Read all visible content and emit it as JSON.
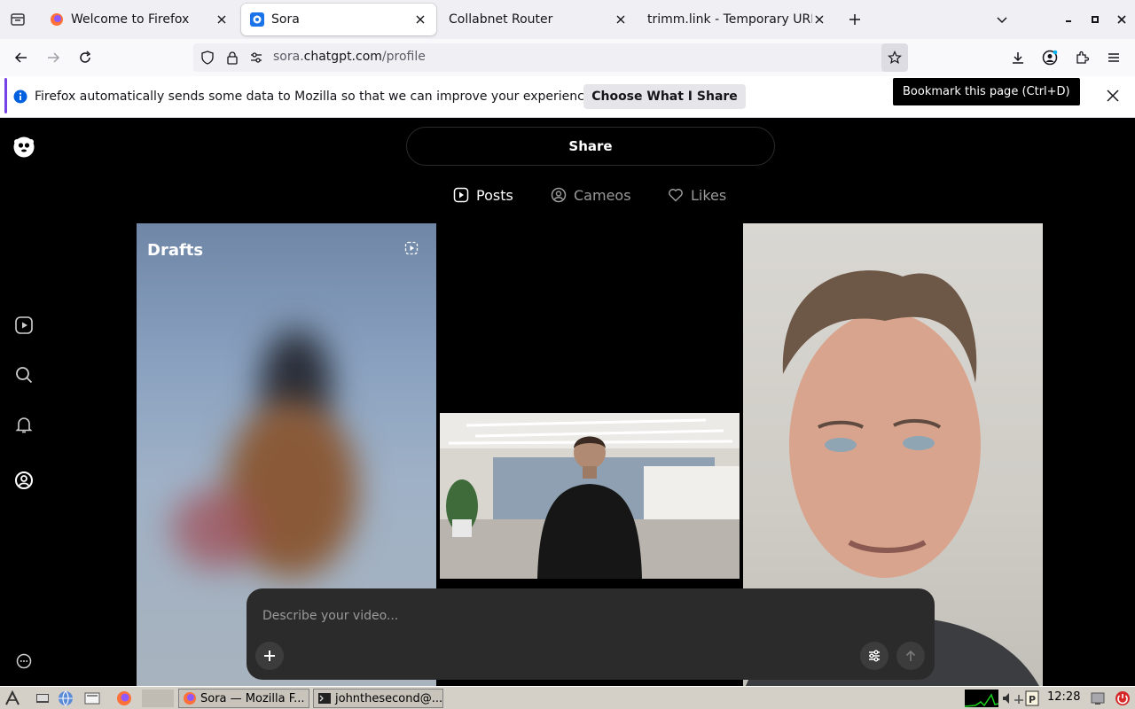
{
  "browser": {
    "tabs": [
      {
        "title": "Welcome to Firefox",
        "active": false
      },
      {
        "title": "Sora",
        "active": true
      },
      {
        "title": "Collabnet Router",
        "active": false
      },
      {
        "title": "trimm.link - Temporary URL",
        "active": false
      }
    ],
    "url": {
      "scheme_prefix": "sora.",
      "host": "chatgpt.com",
      "path": "/profile"
    },
    "tooltip": "Bookmark this page (Ctrl+D)",
    "notification": {
      "text": "Firefox automatically sends some data to Mozilla so that we can improve your experience.",
      "button_label": "Choose What I Share"
    }
  },
  "sora": {
    "share_label": "Share",
    "profile_tabs": [
      {
        "label": "Posts",
        "icon": "play-square-icon",
        "active": true
      },
      {
        "label": "Cameos",
        "icon": "person-circle-icon",
        "active": false
      },
      {
        "label": "Likes",
        "icon": "heart-icon",
        "active": false
      }
    ],
    "drafts_label": "Drafts",
    "prompt": {
      "placeholder": "Describe your video..."
    },
    "sidebar_icons": [
      "sora-logo-icon",
      "video-icon",
      "search-icon",
      "bell-icon",
      "profile-icon",
      "more-icon"
    ]
  },
  "taskbar": {
    "windows": [
      {
        "title": "Sora — Mozilla F..."
      },
      {
        "title": "johnthesecond@..."
      }
    ],
    "clock": "12:28"
  },
  "colors": {
    "accent": "#7542e5",
    "info_blue": "#0060df",
    "page_bg": "#000000"
  }
}
